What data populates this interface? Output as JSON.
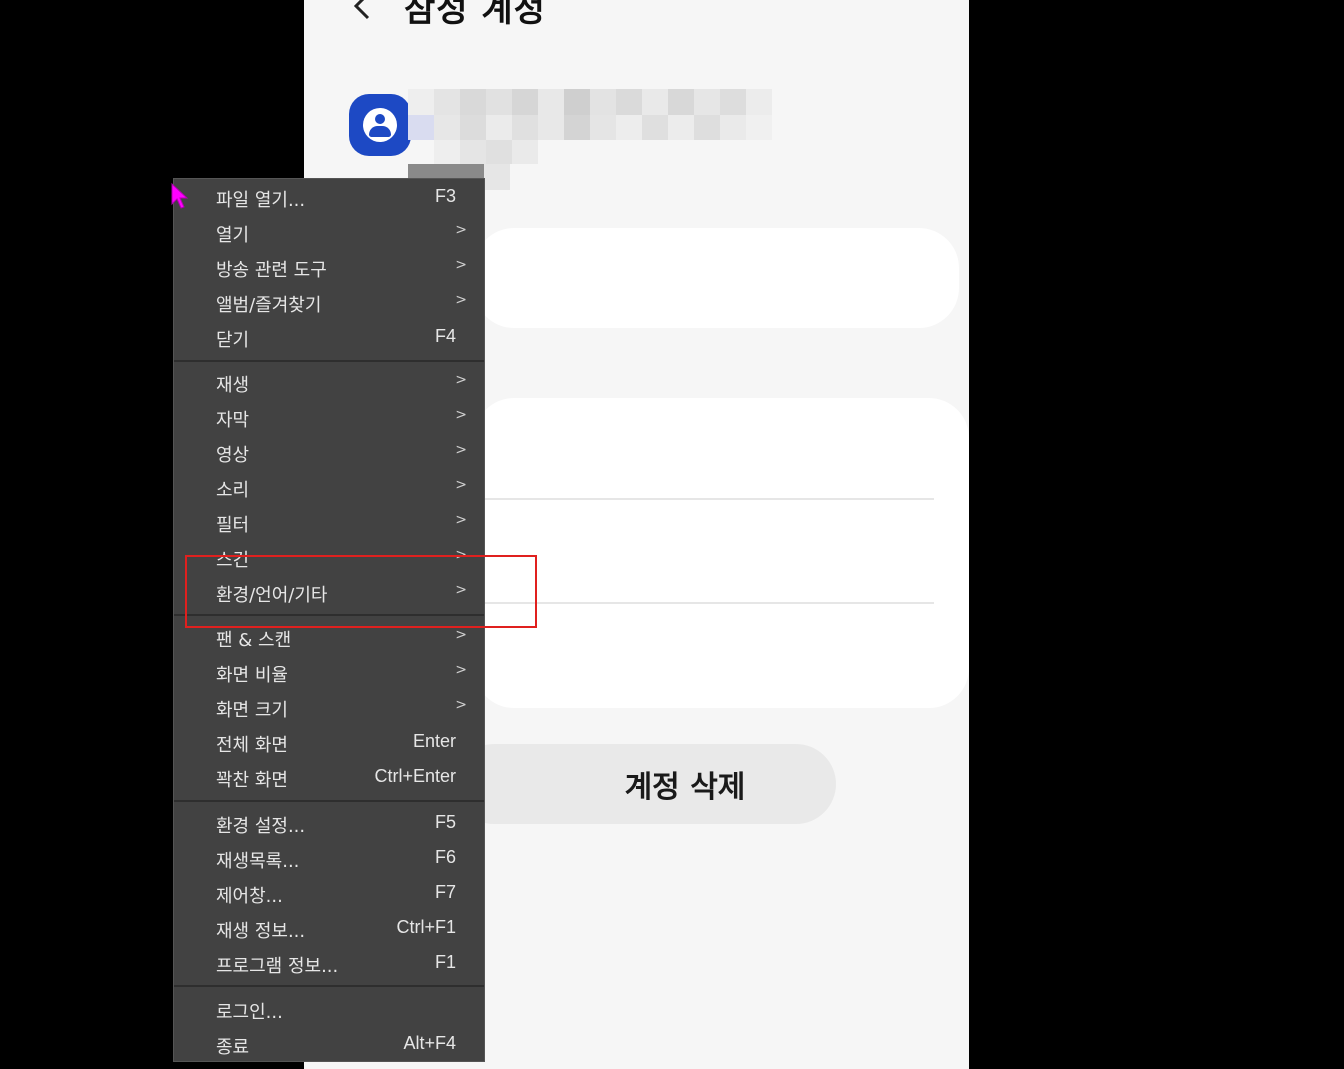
{
  "phone": {
    "title": "삼성 계정",
    "delete_button_label": "계정 삭제"
  },
  "context_menu": {
    "items": [
      {
        "label": "파일 열기...",
        "shortcut": "F3",
        "submenu": false
      },
      {
        "label": "열기",
        "shortcut": "",
        "submenu": true
      },
      {
        "label": "방송 관련 도구",
        "shortcut": "",
        "submenu": true
      },
      {
        "label": "앨범/즐겨찾기",
        "shortcut": "",
        "submenu": true
      },
      {
        "label": "닫기",
        "shortcut": "F4",
        "submenu": false
      },
      {
        "label": "재생",
        "shortcut": "",
        "submenu": true
      },
      {
        "label": "자막",
        "shortcut": "",
        "submenu": true
      },
      {
        "label": "영상",
        "shortcut": "",
        "submenu": true
      },
      {
        "label": "소리",
        "shortcut": "",
        "submenu": true
      },
      {
        "label": "필터",
        "shortcut": "",
        "submenu": true
      },
      {
        "label": "스킨",
        "shortcut": "",
        "submenu": true
      },
      {
        "label": "환경/언어/기타",
        "shortcut": "",
        "submenu": true
      },
      {
        "label": "팬 & 스캔",
        "shortcut": "",
        "submenu": true
      },
      {
        "label": "화면 비율",
        "shortcut": "",
        "submenu": true
      },
      {
        "label": "화면 크기",
        "shortcut": "",
        "submenu": true
      },
      {
        "label": "전체 화면",
        "shortcut": "Enter",
        "submenu": false
      },
      {
        "label": "꽉찬 화면",
        "shortcut": "Ctrl+Enter",
        "submenu": false
      },
      {
        "label": "환경 설정...",
        "shortcut": "F5",
        "submenu": false
      },
      {
        "label": "재생목록...",
        "shortcut": "F6",
        "submenu": false
      },
      {
        "label": "제어창...",
        "shortcut": "F7",
        "submenu": false
      },
      {
        "label": "재생 정보...",
        "shortcut": "Ctrl+F1",
        "submenu": false
      },
      {
        "label": "프로그램 정보...",
        "shortcut": "F1",
        "submenu": false
      },
      {
        "label": "로그인...",
        "shortcut": "",
        "submenu": false
      },
      {
        "label": "종료",
        "shortcut": "Alt+F4",
        "submenu": false
      }
    ],
    "submenu_arrow": ">"
  },
  "colors": {
    "menu_bg": "#424242",
    "menu_text": "#e6e6e6",
    "highlight": "#e0201e",
    "cursor": "#ff00ff",
    "account_blue": "#1d49c4"
  }
}
